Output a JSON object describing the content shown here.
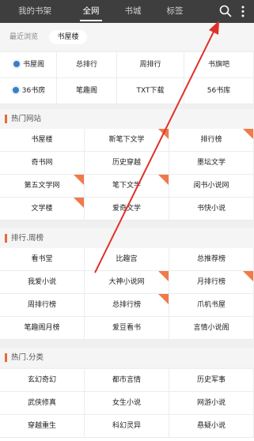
{
  "topbar": {
    "tabs": [
      "我的书架",
      "全网",
      "书城",
      "标签"
    ],
    "active_tab": "全网"
  },
  "subtabs": [
    "最近浏览",
    "书屋楼"
  ],
  "quick_links": [
    {
      "label": "书屋阁",
      "icon": "book-globe-icon"
    },
    {
      "label": "总排行",
      "icon": ""
    },
    {
      "label": "周排行",
      "icon": ""
    },
    {
      "label": "书旗吧",
      "icon": ""
    },
    {
      "label": "36书房",
      "icon": "book-globe-icon"
    },
    {
      "label": "笔趣阁",
      "icon": ""
    },
    {
      "label": "TXT下载",
      "icon": ""
    },
    {
      "label": "56书库",
      "icon": ""
    }
  ],
  "sections": [
    {
      "title": "热门网站",
      "items": [
        "书屋楼",
        "新笔下文学",
        "排行榜",
        "奇书网",
        "历史穿越",
        "墨坛文学",
        "第五文学网",
        "笔下文学",
        "阅书小说网",
        "文学楼",
        "爱奇文学",
        "书快小说"
      ],
      "hot": [
        false,
        true,
        true,
        false,
        false,
        false,
        true,
        true,
        false,
        true,
        false,
        false
      ]
    },
    {
      "title": "排行.周榜",
      "items": [
        "看书堂",
        "比趣宫",
        "总推荐榜",
        "我爱小说",
        "大神小说网",
        "月排行榜",
        "周排行榜",
        "总排行榜",
        "爪机书屋",
        "笔趣阁月榜",
        "爱豆看书",
        "言情小说阁"
      ],
      "hot": [
        false,
        false,
        false,
        false,
        true,
        true,
        false,
        true,
        false,
        false,
        false,
        false
      ]
    },
    {
      "title": "热门.分类",
      "items": [
        "玄幻奇幻",
        "都市言情",
        "历史军事",
        "武侠修真",
        "女生小说",
        "网游小说",
        "穿越重生",
        "科幻灵异",
        "悬疑小说"
      ],
      "hot": [
        false,
        false,
        false,
        false,
        false,
        false,
        false,
        false,
        false
      ]
    }
  ],
  "colors": {
    "topbar": "#3e3e3e",
    "accent": "#e46b3c",
    "ribbon": "#f07a4a",
    "arrow": "#e0302a"
  }
}
